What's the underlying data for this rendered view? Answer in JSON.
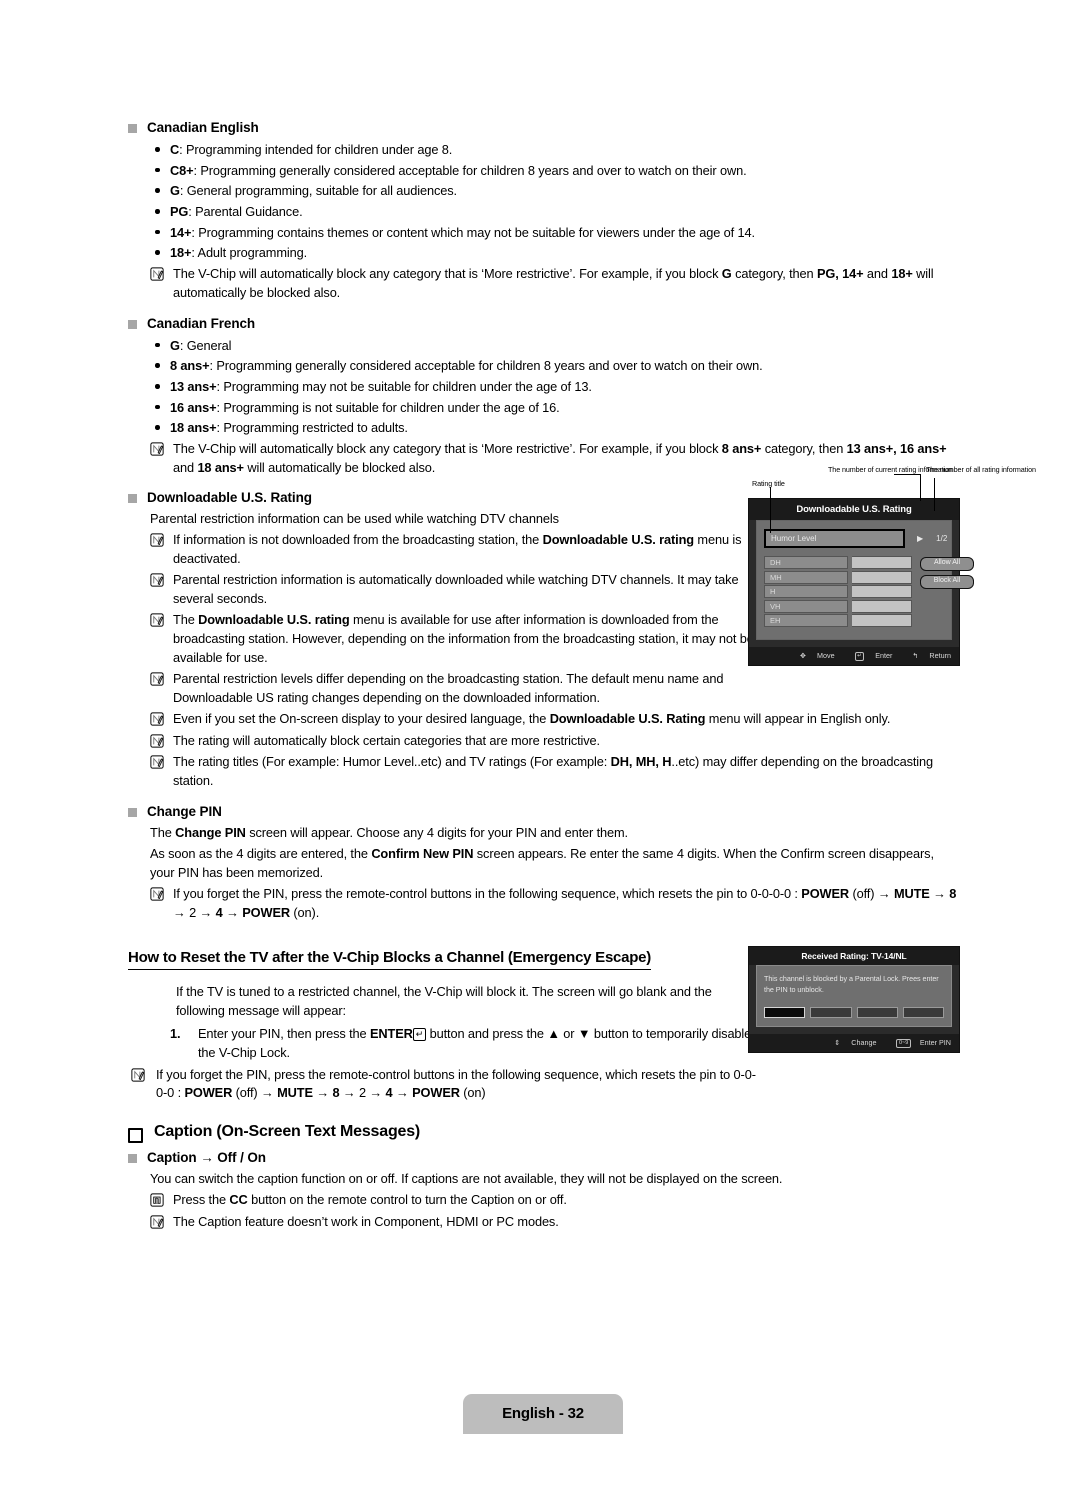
{
  "document": {
    "page_footer": "English - 32"
  },
  "canadian_english": {
    "heading": "Canadian English",
    "items": [
      {
        "term": "C",
        "text": ": Programming intended for children under age 8."
      },
      {
        "term": "C8+",
        "text": ": Programming generally considered acceptable for children 8 years and over to watch on their own."
      },
      {
        "term": "G",
        "text": ": General programming, suitable for all audiences."
      },
      {
        "term": "PG",
        "text": ": Parental Guidance."
      },
      {
        "term": "14+",
        "text": ": Programming contains themes or content which may not be suitable for viewers under the age of 14."
      },
      {
        "term": "18+",
        "text": ": Adult programming."
      }
    ],
    "note": "The V-Chip will automatically block any category that is ‘More restrictive’. For example, if you block G category, then PG, 14+ and 18+ will automatically be blocked also."
  },
  "canadian_french": {
    "heading": "Canadian French",
    "items": [
      {
        "term": "G",
        "text": ": General"
      },
      {
        "term": "8 ans+",
        "text": ": Programming generally considered acceptable for children 8 years and over to watch on their own."
      },
      {
        "term": "13 ans+",
        "text": ": Programming may not be suitable for children under the age of 13."
      },
      {
        "term": "16 ans+",
        "text": ": Programming is not suitable for children under the age of 16."
      },
      {
        "term": "18 ans+",
        "text": ": Programming restricted to adults."
      }
    ],
    "note": "The V-Chip will automatically block any category that is ‘More restrictive’. For example, if you block 8 ans+ category, then 13 ans+, 16 ans+ and 18 ans+ will automatically be blocked also."
  },
  "downloadable_rating": {
    "heading": "Downloadable U.S. Rating",
    "intro": "Parental restriction information can be used while watching DTV channels",
    "notes": [
      "If information is not downloaded from the broadcasting station, the Downloadable U.S. rating menu is deactivated.",
      "Parental restriction information is automatically downloaded while watching DTV channels. It may take several seconds.",
      "The Downloadable U.S. rating menu is available for use after information is downloaded from the broadcasting station. However, depending on the information from the broadcasting station, it may not be available for use.",
      "Parental restriction levels differ depending on the broadcasting station. The default menu name and Downloadable US rating changes depending on the downloaded information.",
      "Even if you set the On-screen display to your desired language, the Downloadable U.S. Rating menu will appear in English only.",
      "The rating will automatically block certain categories that are more restrictive.",
      "The rating titles (For example: Humor Level..etc) and TV ratings (For example: DH, MH, H..etc) may differ depending on the broadcasting station."
    ]
  },
  "figure_rating_menu": {
    "callout_rating_title": "Rating title",
    "callout_current": "The number of current rating information",
    "callout_all": "The number of all rating information",
    "title": "Downloadable U.S. Rating",
    "selected_field": "Humor Level",
    "arrow": "▶",
    "page_indicator": "1/2",
    "rows": [
      "DH",
      "MH",
      "H",
      "VH",
      "EH"
    ],
    "buttons": [
      "Allow All",
      "Block All"
    ],
    "footer": [
      {
        "icon": "dpad-icon",
        "glyph": "✥",
        "label": "Move"
      },
      {
        "icon": "enter-key-icon",
        "glyph": "↵",
        "label": "Enter"
      },
      {
        "icon": "return-icon",
        "glyph": "↰",
        "label": "Return"
      }
    ]
  },
  "change_pin": {
    "heading": "Change PIN",
    "para1": "The Change PIN screen will appear. Choose any 4 digits for your PIN and enter them.",
    "para2": "As soon as the 4 digits are entered, the Confirm New PIN screen appears. Re enter the same 4 digits. When the Confirm screen disappears, your PIN has been memorized.",
    "note": "If you forget the PIN, press the remote-control buttons in the following sequence, which resets the pin to 0-0-0-0 : POWER (off) → MUTE → 8 → 2 → 4 → POWER (on)."
  },
  "reset_tv": {
    "heading": "How to Reset the TV after the V-Chip Blocks a Channel (Emergency Escape)",
    "intro": "If the TV is tuned to a restricted channel, the V-Chip will block it. The screen will go blank and the following message will appear:",
    "step_number": "1.",
    "step_text_a": "Enter your PIN, then press the ",
    "step_enter_label": "ENTER",
    "step_enter_key": "↵",
    "step_text_b": " button and press the ▲ or ▼ button to temporarily disable the V-Chip Lock.",
    "note": "If you forget the PIN, press the remote-control buttons in the following sequence, which resets the pin to 0-0-0-0 : POWER (off) → MUTE → 8 → 2 → 4 → POWER (on)"
  },
  "figure_received_rating": {
    "title": "Received Rating: TV-14/NL",
    "message": "This channel is blocked by a Parental Lock. Prees enter the PIN to unblock.",
    "pin_slots": 4,
    "footer": [
      {
        "icon": "up-down-icon",
        "glyph": "⇕",
        "label": "Change"
      },
      {
        "icon": "number-keys-icon",
        "glyph": "0~9",
        "label": "Enter PIN"
      }
    ]
  },
  "caption": {
    "heading": "Caption (On-Screen Text Messages)",
    "sub_heading": "Caption → Off / On",
    "para": "You can switch the caption function on or off. If captions are not available, they will not be displayed on the screen.",
    "press_note": "Press the CC button on the remote control to turn the Caption on or off.",
    "note": "The Caption feature doesn’t work in Component, HDMI or PC modes."
  },
  "colors": {
    "marker_gray": "#a6a6a6",
    "footer_gray": "#bdbdbd",
    "tv_dark": "#2b2b2b",
    "tv_panel": "#6f6f6f"
  }
}
